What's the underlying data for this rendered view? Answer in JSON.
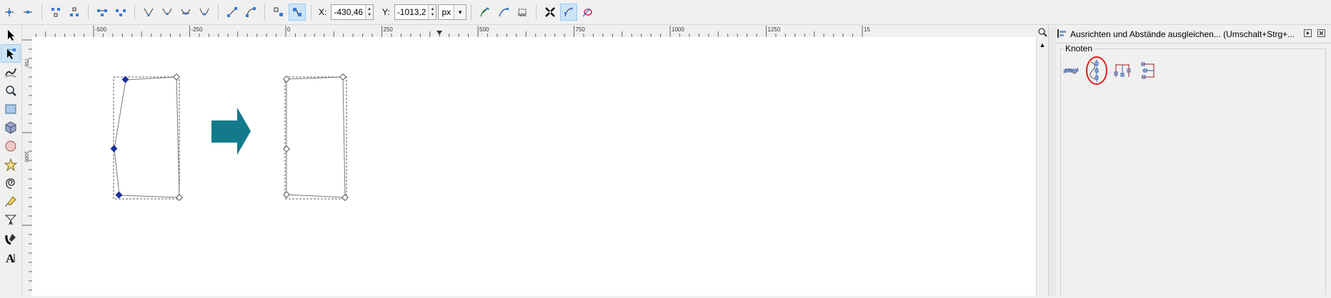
{
  "toolbar": {
    "x_label": "X:",
    "x_value": "-430,46",
    "y_label": "Y:",
    "y_value": "-1013,2",
    "unit": "px"
  },
  "ruler": {
    "h_ticks": [
      "-500",
      "-250",
      "0",
      "250",
      "500",
      "750",
      "1000",
      "1250",
      "15"
    ],
    "v_ticks": [
      "750",
      "1000"
    ]
  },
  "panel": {
    "title": "Ausrichten und Abstände ausgleichen... (Umschalt+Strg+...",
    "group_label": "Knoten"
  },
  "colors": {
    "node_selected": "#1a2fa0",
    "arrow": "#137a8c",
    "annotation": "#e0201c",
    "active_bg": "#cce4f7"
  }
}
